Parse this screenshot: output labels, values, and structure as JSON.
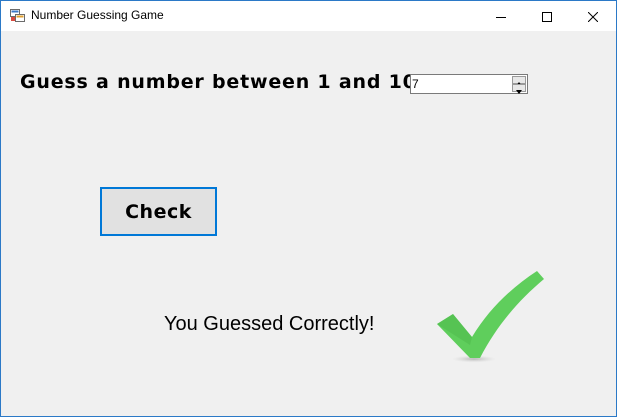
{
  "window": {
    "title": "Number Guessing Game",
    "controls": {
      "minimize": "minimize-icon",
      "maximize": "maximize-icon",
      "close": "close-icon"
    }
  },
  "form": {
    "prompt": "Guess a number between 1 and 10.",
    "guess_value": "7",
    "check_label": "Check",
    "result_text": "You Guessed Correctly!",
    "result_icon": "green-checkmark-icon"
  },
  "colors": {
    "focus_border": "#0078d7",
    "checkmark_green": "#5fce5c",
    "form_background": "#f0f0f0"
  }
}
